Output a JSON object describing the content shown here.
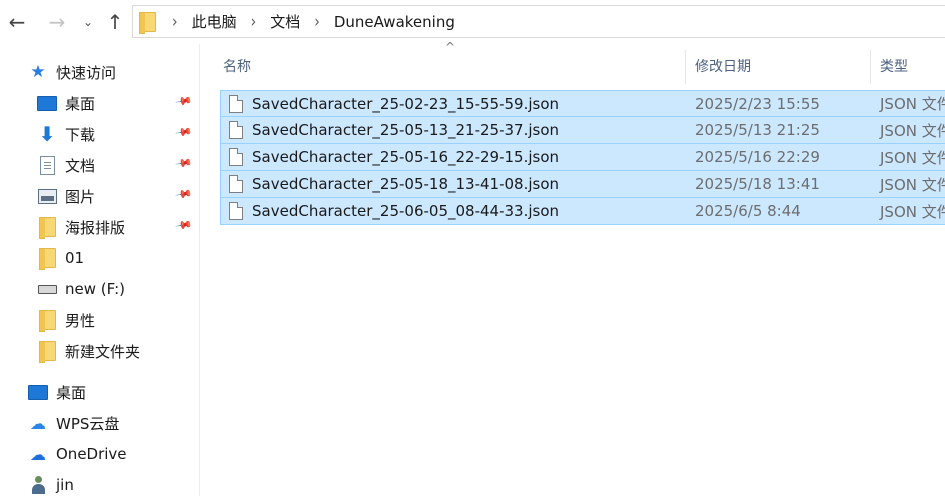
{
  "nav": {
    "back_icon": "←",
    "forward_icon": "→",
    "recent_icon": "⌄",
    "up_icon": "↑"
  },
  "address": {
    "crumbs": [
      "此电脑",
      "文档",
      "DuneAwakening"
    ]
  },
  "sidebar": {
    "items": [
      {
        "label": "快速访问",
        "icon": "star-icon",
        "top": true
      },
      {
        "label": "桌面",
        "icon": "desktop-icon",
        "pinned": true
      },
      {
        "label": "下载",
        "icon": "download-icon",
        "pinned": true
      },
      {
        "label": "文档",
        "icon": "document-icon",
        "pinned": true
      },
      {
        "label": "图片",
        "icon": "picture-icon",
        "pinned": true
      },
      {
        "label": "海报排版",
        "icon": "folder-icon",
        "pinned": true
      },
      {
        "label": "01",
        "icon": "folder-icon"
      },
      {
        "label": "new (F:)",
        "icon": "drive-icon"
      },
      {
        "label": "男性",
        "icon": "folder-icon"
      },
      {
        "label": "新建文件夹",
        "icon": "folder-icon"
      },
      {
        "label": "桌面",
        "icon": "desktop-icon",
        "top": true
      },
      {
        "label": "WPS云盘",
        "icon": "wps-cloud-icon",
        "top": true
      },
      {
        "label": "OneDrive",
        "icon": "onedrive-icon",
        "top": true
      },
      {
        "label": "jin",
        "icon": "user-icon",
        "top": true
      }
    ]
  },
  "columns": {
    "name": "名称",
    "date": "修改日期",
    "type": "类型"
  },
  "files": [
    {
      "name": "SavedCharacter_25-02-23_15-55-59.json",
      "date": "2025/2/23 15:55",
      "type": "JSON 文件"
    },
    {
      "name": "SavedCharacter_25-05-13_21-25-37.json",
      "date": "2025/5/13 21:25",
      "type": "JSON 文件"
    },
    {
      "name": "SavedCharacter_25-05-16_22-29-15.json",
      "date": "2025/5/16 22:29",
      "type": "JSON 文件"
    },
    {
      "name": "SavedCharacter_25-05-18_13-41-08.json",
      "date": "2025/5/18 13:41",
      "type": "JSON 文件"
    },
    {
      "name": "SavedCharacter_25-06-05_08-44-33.json",
      "date": "2025/6/5 8:44",
      "type": "JSON 文件"
    }
  ],
  "colors": {
    "selection_bg": "#cce8ff",
    "selection_border": "#99d1ff",
    "header_text": "#4d6282"
  }
}
